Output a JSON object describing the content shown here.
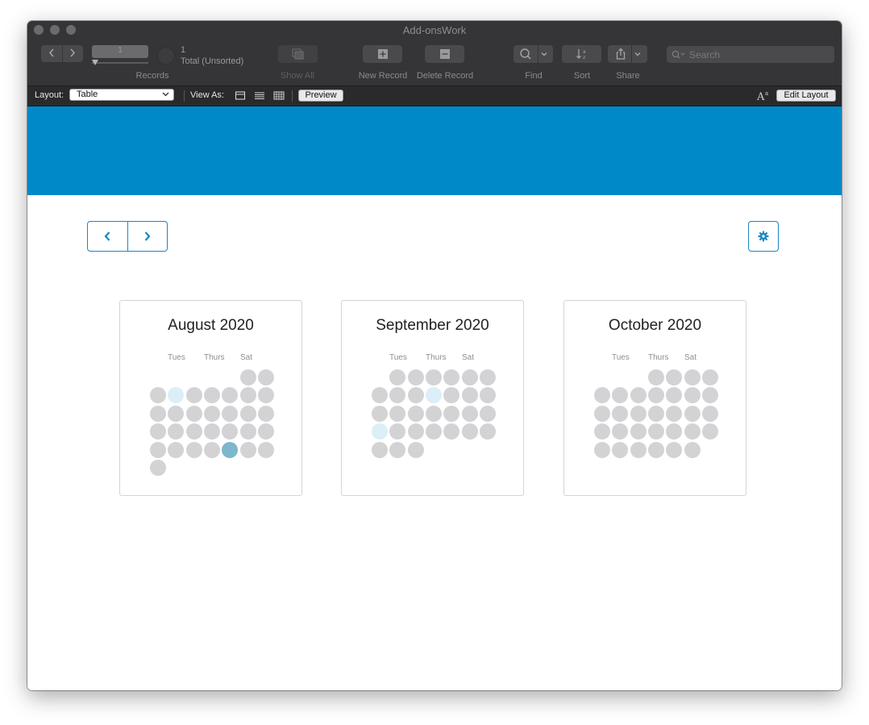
{
  "window": {
    "title": "Add-onsWork"
  },
  "toolbar": {
    "record_field": "1",
    "record_count": "1",
    "total_label": "Total (Unsorted)",
    "records_label": "Records",
    "show_all_label": "Show All",
    "new_record_label": "New Record",
    "delete_record_label": "Delete Record",
    "find_label": "Find",
    "sort_label": "Sort",
    "share_label": "Share",
    "search_placeholder": "Search"
  },
  "layoutbar": {
    "layout_label": "Layout:",
    "layout_value": "Table",
    "view_as_label": "View As:",
    "preview_label": "Preview",
    "edit_layout_label": "Edit Layout"
  },
  "calendars": [
    {
      "title": "August 2020",
      "days": [
        "Tues",
        "Thurs",
        "Sat"
      ],
      "rows": [
        [
          "",
          "",
          "",
          "",
          "",
          "o",
          "o"
        ],
        [
          "o",
          "l",
          "o",
          "o",
          "o",
          "o",
          "o"
        ],
        [
          "o",
          "o",
          "o",
          "o",
          "o",
          "o",
          "o"
        ],
        [
          "o",
          "o",
          "o",
          "o",
          "o",
          "o",
          "o"
        ],
        [
          "o",
          "o",
          "o",
          "o",
          "m",
          "o",
          "o"
        ],
        [
          "o",
          "",
          "",
          "",
          "",
          "",
          ""
        ]
      ]
    },
    {
      "title": "September 2020",
      "days": [
        "Tues",
        "Thurs",
        "Sat"
      ],
      "rows": [
        [
          "",
          "o",
          "o",
          "o",
          "o",
          "o",
          "o"
        ],
        [
          "o",
          "o",
          "o",
          "l",
          "o",
          "o",
          "o"
        ],
        [
          "o",
          "o",
          "o",
          "o",
          "o",
          "o",
          "o"
        ],
        [
          "l",
          "o",
          "o",
          "o",
          "o",
          "o",
          "o"
        ],
        [
          "o",
          "o",
          "o",
          "",
          "",
          "",
          ""
        ]
      ]
    },
    {
      "title": "October 2020",
      "days": [
        "Tues",
        "Thurs",
        "Sat"
      ],
      "rows": [
        [
          "",
          "",
          "",
          "o",
          "o",
          "o",
          "o"
        ],
        [
          "o",
          "o",
          "o",
          "o",
          "o",
          "o",
          "o"
        ],
        [
          "o",
          "o",
          "o",
          "o",
          "o",
          "o",
          "o"
        ],
        [
          "o",
          "o",
          "o",
          "o",
          "o",
          "o",
          "o"
        ],
        [
          "o",
          "o",
          "o",
          "o",
          "o",
          "o",
          ""
        ]
      ]
    }
  ]
}
